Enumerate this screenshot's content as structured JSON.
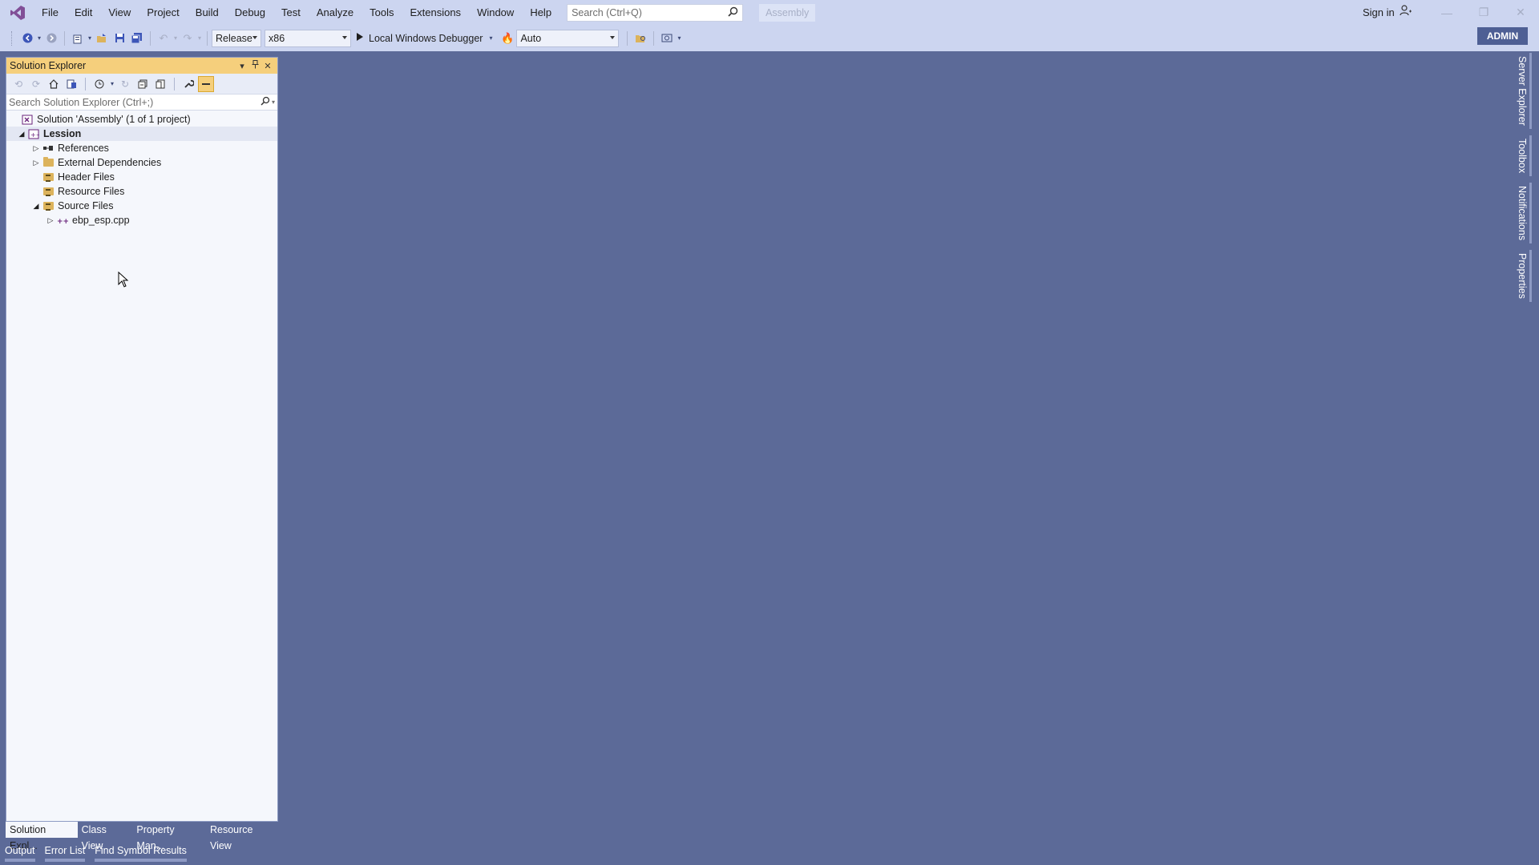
{
  "menu": {
    "items": [
      "File",
      "Edit",
      "View",
      "Project",
      "Build",
      "Debug",
      "Test",
      "Analyze",
      "Tools",
      "Extensions",
      "Window",
      "Help"
    ]
  },
  "search": {
    "placeholder": "Search (Ctrl+Q)"
  },
  "solution_badge": "Assembly",
  "signin": {
    "label": "Sign in"
  },
  "toolbar": {
    "config": "Release",
    "platform": "x86",
    "debugger": "Local Windows Debugger",
    "auto": "Auto"
  },
  "admin_badge": "ADMIN",
  "solution_explorer": {
    "title": "Solution Explorer",
    "search_placeholder": "Search Solution Explorer (Ctrl+;)",
    "solution_label": "Solution 'Assembly' (1 of 1 project)",
    "project": "Lession",
    "references": "References",
    "external_deps": "External Dependencies",
    "header_files": "Header Files",
    "resource_files": "Resource Files",
    "source_files": "Source Files",
    "source_file": "ebp_esp.cpp"
  },
  "bottom_tabs": [
    "Solution Expl...",
    "Class View",
    "Property Man...",
    "Resource View"
  ],
  "output_tabs": [
    "Output",
    "Error List",
    "Find Symbol Results"
  ],
  "side_tabs": [
    "Server Explorer",
    "Toolbox",
    "Notifications",
    "Properties"
  ],
  "colors": {
    "background": "#5c6a98",
    "chrome": "#ccd5f0",
    "panel_header": "#f5cf7c",
    "admin": "#4e5f94"
  }
}
